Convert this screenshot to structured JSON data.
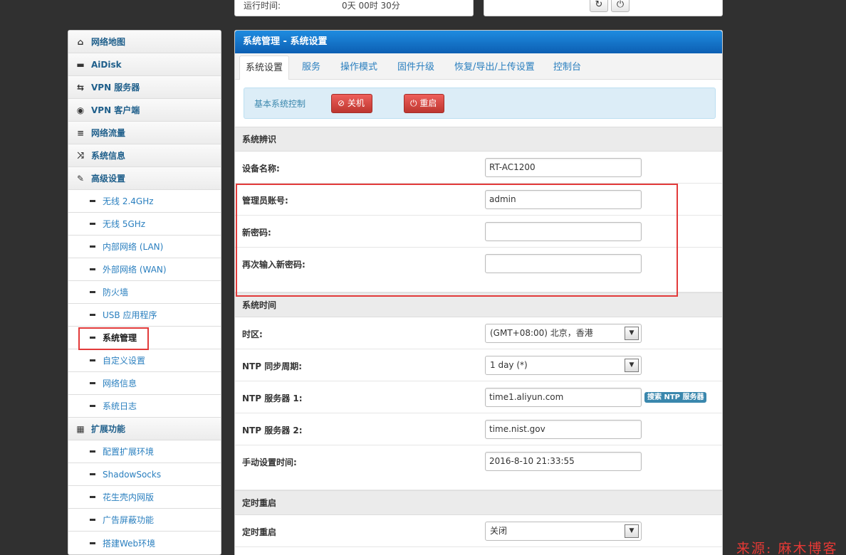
{
  "status_bar": {
    "uptime_label": "运行时间:",
    "uptime_value": "0天 00时 30分",
    "refresh_icon": "↻",
    "power_icon": "⏻"
  },
  "sidebar": {
    "items": [
      {
        "label": "网络地图",
        "icon": "⌂",
        "type": "top"
      },
      {
        "label": "AiDisk",
        "icon": "▬",
        "type": "top"
      },
      {
        "label": "VPN 服务器",
        "icon": "⇆",
        "type": "top"
      },
      {
        "label": "VPN 客户端",
        "icon": "◉",
        "type": "top"
      },
      {
        "label": "网络流量",
        "icon": "≡",
        "type": "top"
      },
      {
        "label": "系统信息",
        "icon": "⤨",
        "type": "top"
      },
      {
        "label": "高级设置",
        "icon": "✎",
        "type": "top"
      },
      {
        "label": "无线 2.4GHz",
        "type": "sub"
      },
      {
        "label": "无线 5GHz",
        "type": "sub"
      },
      {
        "label": "内部网络 (LAN)",
        "type": "sub"
      },
      {
        "label": "外部网络 (WAN)",
        "type": "sub"
      },
      {
        "label": "防火墙",
        "type": "sub"
      },
      {
        "label": "USB 应用程序",
        "type": "sub"
      },
      {
        "label": "系统管理",
        "type": "sub",
        "active": true
      },
      {
        "label": "自定义设置",
        "type": "sub"
      },
      {
        "label": "网络信息",
        "type": "sub"
      },
      {
        "label": "系统日志",
        "type": "sub"
      },
      {
        "label": "扩展功能",
        "icon": "▦",
        "type": "top"
      },
      {
        "label": "配置扩展环境",
        "type": "sub"
      },
      {
        "label": "ShadowSocks",
        "type": "sub"
      },
      {
        "label": "花生壳内网版",
        "type": "sub"
      },
      {
        "label": "广告屏蔽功能",
        "type": "sub"
      },
      {
        "label": "搭建Web环境",
        "type": "sub"
      }
    ]
  },
  "panel": {
    "title": "系统管理 - 系统设置",
    "tabs": [
      "系统设置",
      "服务",
      "操作模式",
      "固件升级",
      "恢复/导出/上传设置",
      "控制台"
    ],
    "alert": {
      "text": "基本系统控制",
      "shutdown_label": "关机",
      "reboot_label": "重启"
    },
    "sections": {
      "identity": "系统辨识",
      "time": "系统时间",
      "scheduled_reboot": "定时重启"
    },
    "fields": {
      "device_name_label": "设备名称:",
      "device_name_value": "RT-AC1200",
      "admin_label": "管理员账号:",
      "admin_value": "admin",
      "new_password_label": "新密码:",
      "new_password_value": "",
      "confirm_password_label": "再次输入新密码:",
      "confirm_password_value": "",
      "timezone_label": "时区:",
      "timezone_value": "(GMT+08:00) 北京，香港",
      "ntp_period_label": "NTP 同步周期:",
      "ntp_period_value": "1 day (*)",
      "ntp_server1_label": "NTP 服务器 1:",
      "ntp_server1_value": "time1.aliyun.com",
      "ntp_search_label": "搜索 NTP 服务器",
      "ntp_server2_label": "NTP 服务器 2:",
      "ntp_server2_value": "time.nist.gov",
      "manual_time_label": "手动设置时间:",
      "manual_time_value": "2016-8-10 21:33:55",
      "reboot_label": "定时重启",
      "reboot_value": "关闭"
    }
  },
  "watermark": "来源: 麻木博客",
  "colors": {
    "accent": "#0c5fb3",
    "link": "#2a7fbf",
    "danger": "#bd362f",
    "highlight": "#e23a3a"
  }
}
